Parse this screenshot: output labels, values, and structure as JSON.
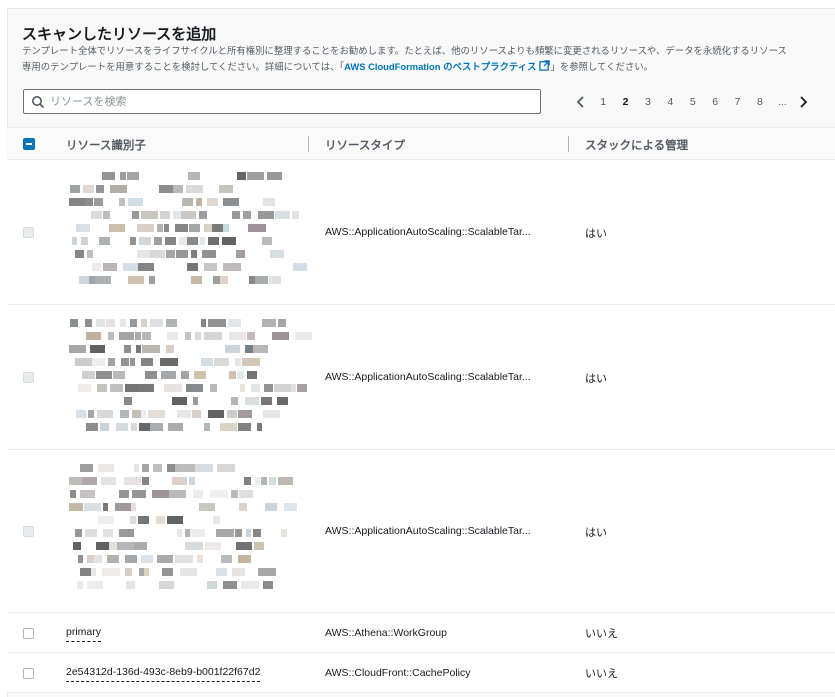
{
  "header": {
    "title": "スキャンしたリソースを追加",
    "desc_line1": "テンプレート全体でリソースをライフサイクルと所有権別に整理することをお勧めします。たとえば、他のリソースよりも頻繁に変更されるリソースや、データを永続化するリソース",
    "desc_line2_before": "専用のテンプレートを用意することを検討してください。詳細については、「",
    "desc_link": "AWS CloudFormation のベストプラクティス",
    "desc_line2_after": "」を参照してください。"
  },
  "search": {
    "placeholder": "リソースを検索",
    "value": ""
  },
  "pagination": {
    "pages": [
      "1",
      "2",
      "3",
      "4",
      "5",
      "6",
      "7",
      "8",
      "..."
    ],
    "current": "2"
  },
  "table": {
    "columns": [
      "リソース識別子",
      "リソースタイプ",
      "スタックによる管理"
    ],
    "rows": [
      {
        "identifier": "",
        "type": "AWS::ApplicationAutoScaling::ScalableTar...",
        "managed": "はい",
        "redacted": true
      },
      {
        "identifier": "",
        "type": "AWS::ApplicationAutoScaling::ScalableTar...",
        "managed": "はい",
        "redacted": true
      },
      {
        "identifier": "",
        "type": "AWS::ApplicationAutoScaling::ScalableTar...",
        "managed": "はい",
        "redacted": true
      },
      {
        "identifier": "primary",
        "type": "AWS::Athena::WorkGroup",
        "managed": "いいえ",
        "redacted": false
      },
      {
        "identifier": "2e54312d-136d-493c-8eb9-b001f22f67d2",
        "type": "AWS::CloudFront::CachePolicy",
        "managed": "いいえ",
        "redacted": false
      }
    ]
  },
  "colors": {
    "accent": "#0073bb",
    "text": "#16191f",
    "muted": "#545b64",
    "border": "#eaeded"
  },
  "icons": {
    "search": "search-icon",
    "external": "external-link-icon",
    "prev": "chevron-left-icon",
    "next": "chevron-right-icon"
  }
}
